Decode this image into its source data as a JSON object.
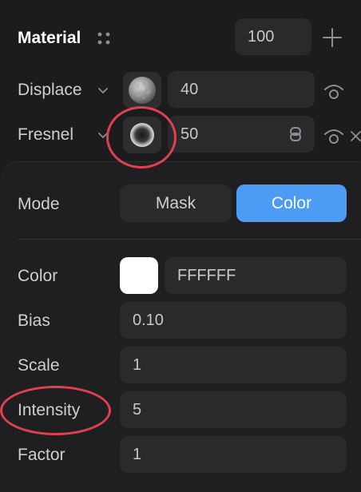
{
  "header": {
    "title": "Material",
    "value": "100",
    "add_icon": "plus-icon",
    "drag_icon": "drag-handle-icon"
  },
  "layers": [
    {
      "label": "Displace",
      "value": "40",
      "thumbnail": "noise-texture",
      "visibility_icon": "eye-icon"
    },
    {
      "label": "Fresnel",
      "value": "50",
      "thumbnail": "fresnel-texture",
      "visibility_icon": "eye-icon",
      "link_icon": "link-icon",
      "remove_icon": "close-icon"
    }
  ],
  "fresnel_panel": {
    "mode_label": "Mode",
    "mode_options": [
      "Mask",
      "Color"
    ],
    "mode_selected": "Color",
    "color_label": "Color",
    "color_hex": "FFFFFF",
    "bias_label": "Bias",
    "bias_value": "0.10",
    "scale_label": "Scale",
    "scale_value": "1",
    "intensity_label": "Intensity",
    "intensity_value": "5",
    "factor_label": "Factor",
    "factor_value": "1"
  },
  "colors": {
    "accent": "#4c9bf5",
    "annotation": "#e0404f",
    "swatch": "#ffffff"
  }
}
